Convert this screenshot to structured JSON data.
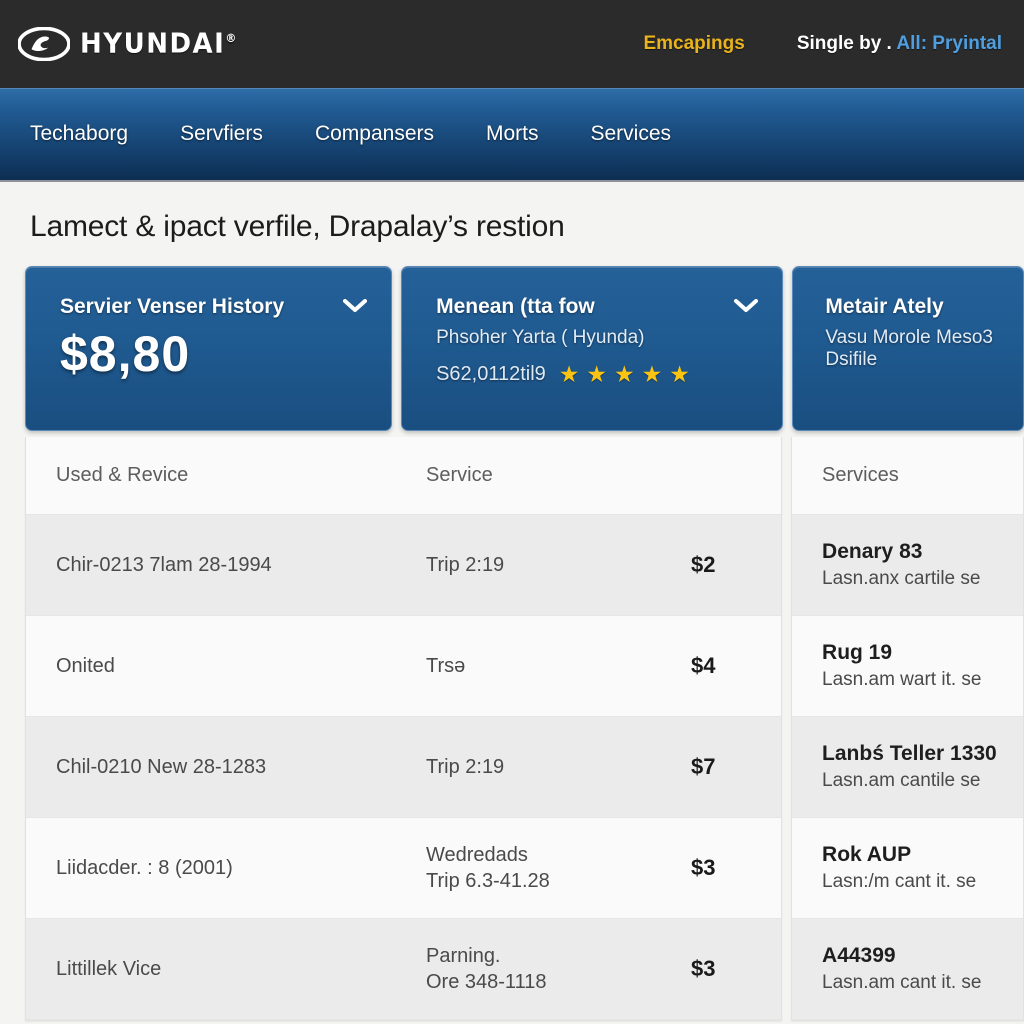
{
  "topbar": {
    "brand_name": "HYUNDAI",
    "brand_reg": "®",
    "logo_icon": "hyundai-oval-logo",
    "link_gold": "Emcapings",
    "link_white": "Single by .",
    "link_blue": "All: Pryintal"
  },
  "nav": {
    "items": [
      {
        "label": "Techaborg"
      },
      {
        "label": "Servfiers"
      },
      {
        "label": "Compansers"
      },
      {
        "label": "Morts"
      },
      {
        "label": "Services"
      }
    ]
  },
  "main": {
    "page_title": "Lamect & ipact verfile, Drapalay’s restion"
  },
  "cards": [
    {
      "title": "Servier Venser History",
      "chevron_icon": "chevron-down-icon",
      "big_value": "$8,80"
    },
    {
      "title": "Menean (tta fow",
      "chevron_icon": "chevron-down-icon",
      "subtitle": "Phsoher Yarta ( Hyunda)",
      "price": "S62,0112til9",
      "star_icon": "star-icon",
      "stars": 5
    },
    {
      "title": "Metair Ately",
      "subtitle": "Vasu Morole Meso3",
      "subtitle2": "Dsifile"
    }
  ],
  "left_table": {
    "headers": [
      "Used & Revice",
      "Service",
      ""
    ],
    "rows": [
      {
        "a": "Chir-0213 7lam 28-1994",
        "b1": "Trip 2:19",
        "b2": "",
        "price": "$2",
        "shade": "alt"
      },
      {
        "a": "Onited",
        "b1": "Trsə",
        "b2": "",
        "price": "$4",
        "shade": "plain"
      },
      {
        "a": "Chil-0210 New 28-1283",
        "b1": "Trip 2:19",
        "b2": "",
        "price": "$7",
        "shade": "alt"
      },
      {
        "a": "Liidacder. : 8 (2001)",
        "b1": "Wedredads",
        "b2": "Trip 6.3-41.28",
        "price": "$3",
        "shade": "plain"
      },
      {
        "a": "Littillek Vice",
        "b1": "Parning.",
        "b2": "Ore 348-1118",
        "price": "$3",
        "shade": "alt"
      }
    ]
  },
  "right_table": {
    "header": "Services",
    "rows": [
      {
        "title": "Denary 83",
        "desc": "Lasn.anx cartile se",
        "shade": "alt"
      },
      {
        "title": "Rug 19",
        "desc": "Lasn.am wart it. se",
        "shade": "plain"
      },
      {
        "title": "Lanbś Teller 1330",
        "desc": "Lasn.am cantile se",
        "shade": "alt"
      },
      {
        "title": "Rok AUP",
        "desc": "Lasn:/m cant it. se",
        "shade": "plain"
      },
      {
        "title": "A44399",
        "desc": "Lasn.am cant it. se",
        "shade": "alt"
      }
    ]
  },
  "colors": {
    "topbar_bg": "#2b2b2b",
    "nav_blue_top": "#2e6ea8",
    "nav_blue_bottom": "#0d2e52",
    "card_blue": "#1f5a90",
    "accent_gold": "#e8b31c",
    "star_gold": "#fbc412",
    "link_blue": "#4f9fe0",
    "page_bg": "#f4f4f2",
    "row_alt": "#ebebeb"
  }
}
